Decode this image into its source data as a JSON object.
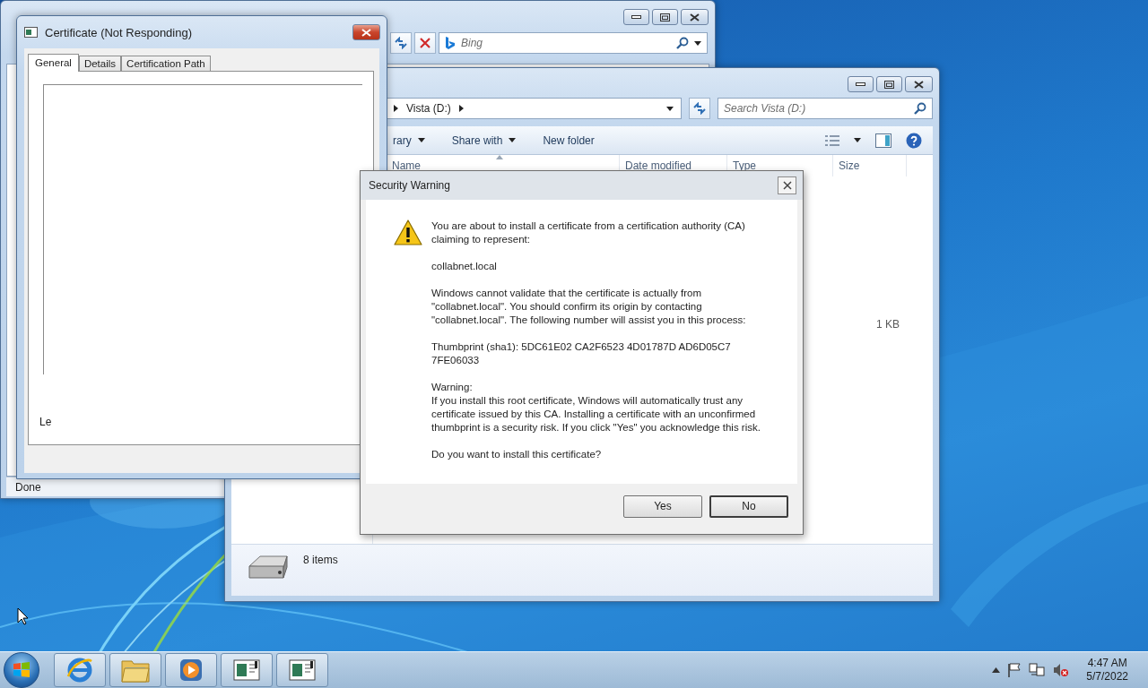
{
  "browser_window": {
    "search_placeholder": "Bing",
    "status": "Done"
  },
  "explorer_window": {
    "address": "Vista (D:)",
    "search_placeholder": "Search Vista (D:)",
    "toolbar": [
      {
        "label": "rary",
        "menu": true
      },
      {
        "label": "Share with",
        "menu": true
      },
      {
        "label": "New folder",
        "menu": false
      }
    ],
    "columns": [
      {
        "label": "Name",
        "sorted": true
      },
      {
        "label": "Date modified",
        "sorted": false
      },
      {
        "label": "Type",
        "sorted": false
      },
      {
        "label": "Size",
        "sorted": false
      }
    ],
    "rows": [
      {
        "size": "1 KB"
      }
    ],
    "status": "8 items"
  },
  "certificate_window": {
    "title": "Certificate (Not Responding)",
    "tabs": [
      {
        "label": "General",
        "selected": true
      },
      {
        "label": "Details",
        "selected": false
      },
      {
        "label": "Certification Path",
        "selected": false
      }
    ],
    "fragment": "Le"
  },
  "security_dialog": {
    "title": "Security Warning",
    "paragraphs": [
      [
        "You are about to install a certificate from a certification authority (CA) claiming to represent:"
      ],
      [
        "collabnet.local"
      ],
      [
        "Windows cannot validate that the certificate is actually from \"collabnet.local\". You should confirm its origin by contacting \"collabnet.local\". The following number will assist you in this process:"
      ],
      [
        "Thumbprint (sha1): 5DC61E02 CA2F6523 4D01787D AD6D05C7 7FE06033"
      ],
      [
        "Warning:",
        "If you install this root certificate, Windows will automatically trust any certificate issued by this CA. Installing a certificate with an unconfirmed thumbprint is a security risk. If you click \"Yes\" you acknowledge this risk."
      ],
      [
        "Do you want to install this certificate?"
      ]
    ],
    "buttons": [
      {
        "label": "Yes",
        "focused": false
      },
      {
        "label": "No",
        "focused": true
      }
    ]
  },
  "taskbar": {
    "apps": [
      {
        "kind": "browser"
      },
      {
        "kind": "folder"
      },
      {
        "kind": "media"
      },
      {
        "kind": "certificate"
      },
      {
        "kind": "certificate"
      }
    ],
    "time": "4:47 AM",
    "date": "5/7/2022"
  }
}
